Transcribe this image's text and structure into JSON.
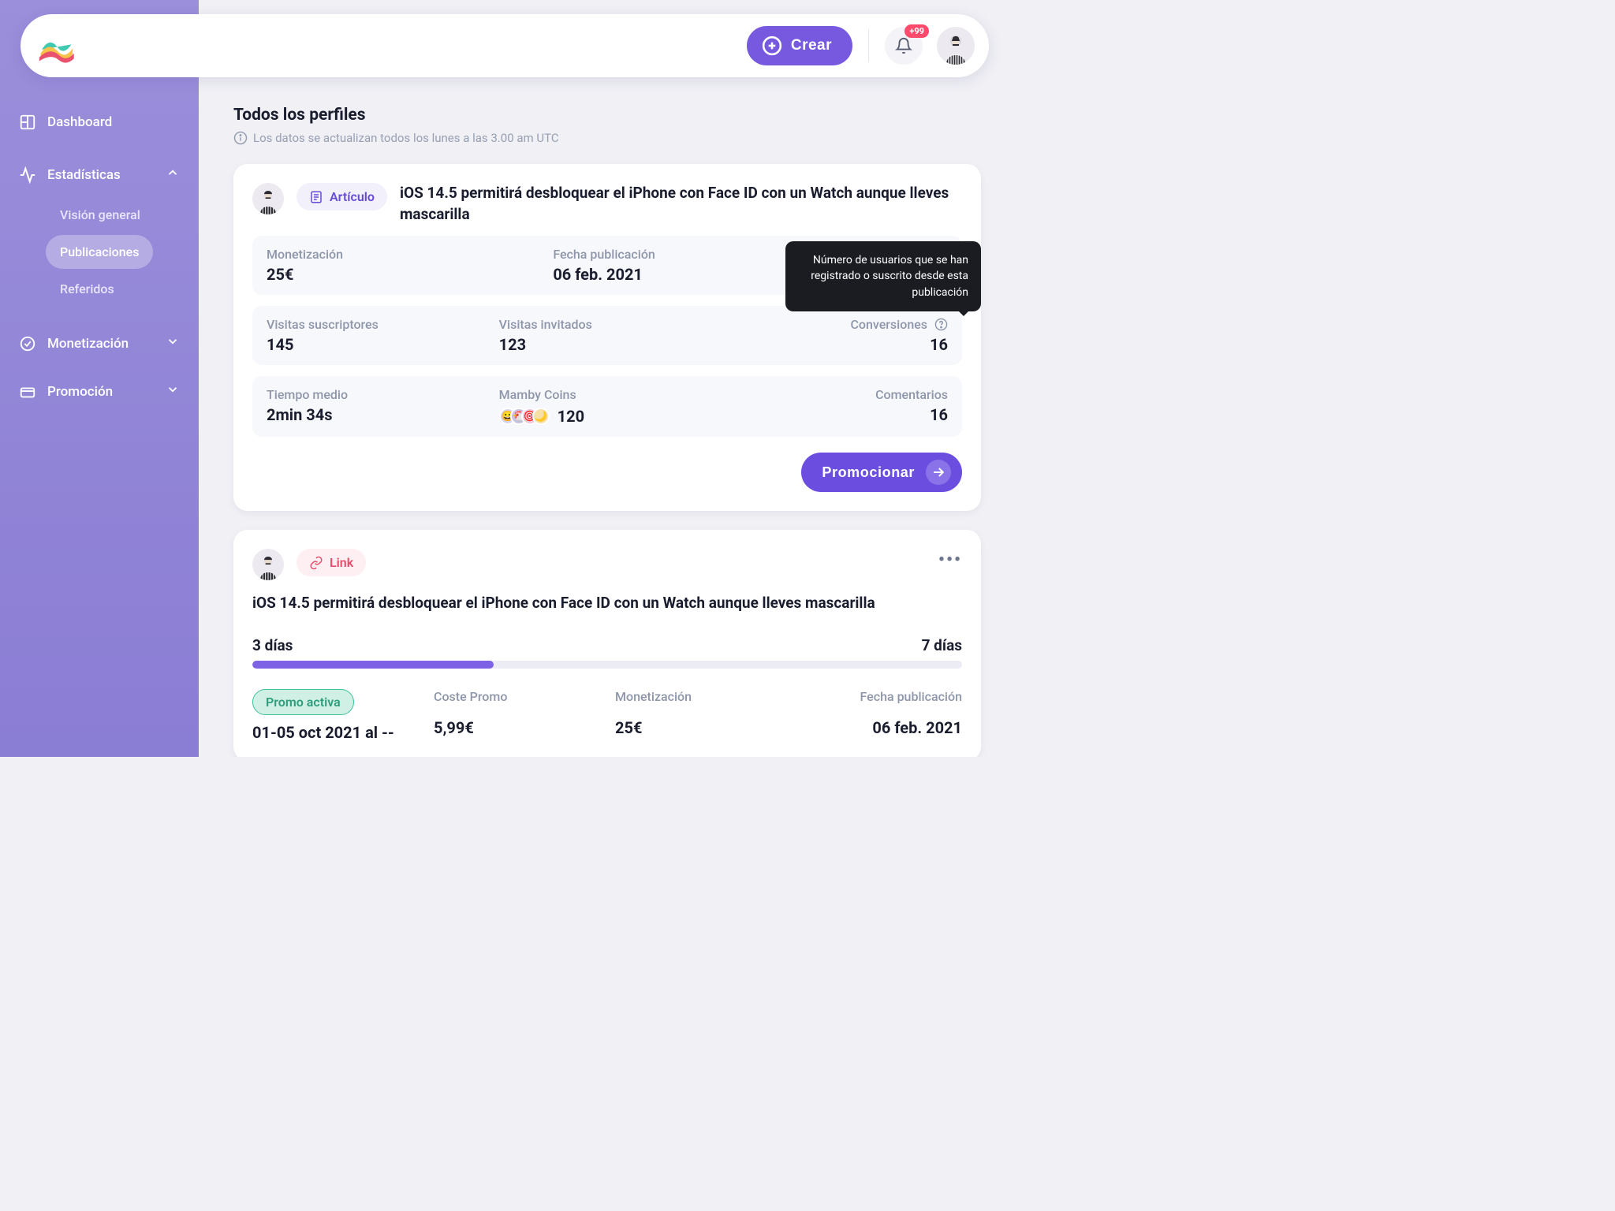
{
  "topnav": {
    "create_label": "Crear",
    "notif_badge": "+99"
  },
  "sidebar": {
    "dashboard": "Dashboard",
    "stats": "Estadísticas",
    "stats_sub": {
      "overview": "Visión general",
      "publications": "Publicaciones",
      "referrals": "Referidos"
    },
    "monetization": "Monetización",
    "promotion": "Promoción"
  },
  "main": {
    "title": "Todos los perfiles",
    "update_note": "Los datos se actualizan todos los lunes a las 3.00 am UTC"
  },
  "tooltip": {
    "text": "Número de usuarios que se han registrado o suscrito desde esta publicación"
  },
  "card1": {
    "tag": "Artículo",
    "title": "iOS 14.5 permitirá desbloquear el iPhone con Face ID con un Watch aunque lleves mascarilla",
    "stats": {
      "monet_label": "Monetización",
      "monet_val": "25€",
      "pubdate_label": "Fecha publicación",
      "pubdate_val": "06 feb. 2021",
      "sub_visits_label": "Visitas suscriptores",
      "sub_visits_val": "145",
      "guest_visits_label": "Visitas invitados",
      "guest_visits_val": "123",
      "conversions_label": "Conversiones",
      "conversions_val": "16",
      "avgtime_label": "Tiempo medio",
      "avgtime_val": "2min 34s",
      "coins_label": "Mamby Coins",
      "coins_val": "120",
      "comments_label": "Comentarios",
      "comments_val": "16"
    },
    "promo_btn": "Promocionar"
  },
  "card2": {
    "tag": "Link",
    "title": "iOS 14.5 permitirá desbloquear el iPhone con Face ID con un Watch aunque lleves mascarilla",
    "prog_left": "3 días",
    "prog_right": "7 días",
    "promo_active": "Promo activa",
    "daterange": "01-05 oct 2021 al --",
    "cost_label": "Coste Promo",
    "cost_val": "5,99€",
    "monet_label": "Monetización",
    "monet_val": "25€",
    "pubdate_label": "Fecha publicación",
    "pubdate_val": "06 feb. 2021"
  }
}
